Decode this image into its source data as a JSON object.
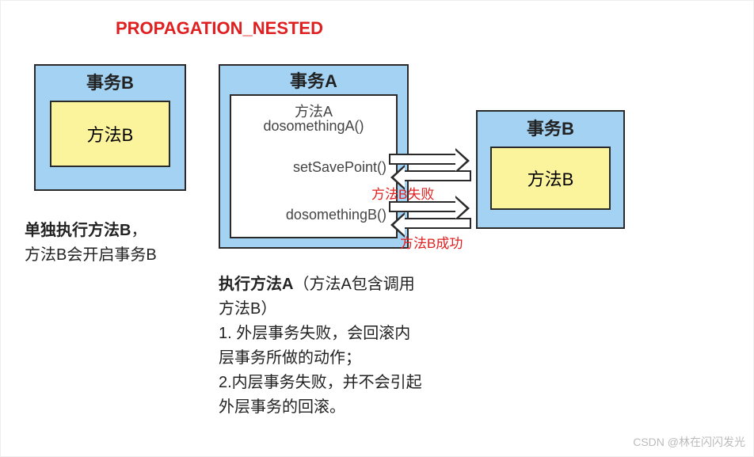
{
  "title": "PROPAGATION_NESTED",
  "left": {
    "txTitle": "事务B",
    "method": "方法B",
    "caption_bold": "单独执行方法B",
    "caption_rest": "，\n方法B会开启事务B"
  },
  "center": {
    "txTitle": "事务A",
    "line1": "方法A",
    "line2": "dosomethingA()",
    "line3": "setSavePoint()",
    "line4": "dosomethingB()",
    "caption_bold": "执行方法A",
    "caption_rest": "（方法A包含调用方法B）\n1. 外层事务失败，会回滚内层事务所做的动作；\n2.内层事务失败，并不会引起外层事务的回滚。"
  },
  "right": {
    "txTitle": "事务B",
    "method": "方法B"
  },
  "arrows": {
    "fail_label": "方法B失败",
    "success_label": "方法B成功"
  },
  "watermark": "CSDN @林在闪闪发光"
}
